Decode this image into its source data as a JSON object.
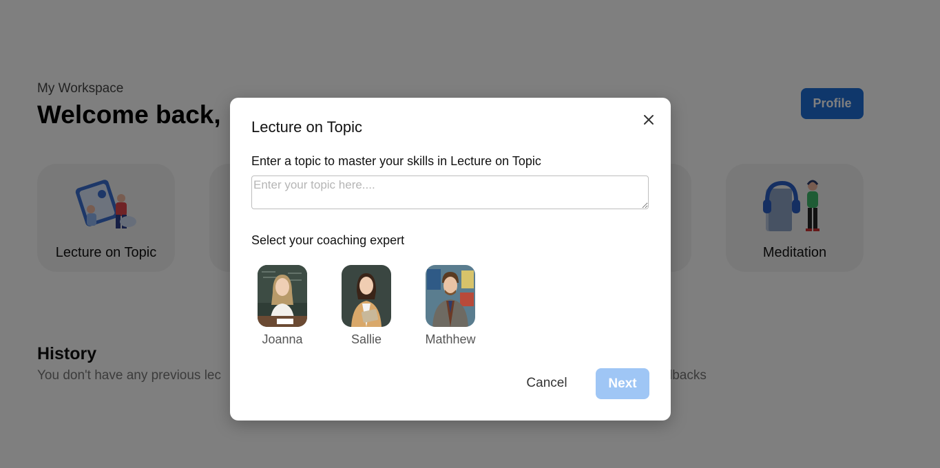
{
  "workspace": {
    "label": "My Workspace",
    "welcome": "Welcome back,",
    "profile_button": "Profile"
  },
  "cards": [
    {
      "label": "Lecture on Topic",
      "icon": "lecture-illustration-icon"
    },
    {
      "label": "",
      "icon": "hidden-card"
    },
    {
      "label": "",
      "icon": "hidden-card"
    },
    {
      "label": "",
      "icon": "hidden-card"
    },
    {
      "label": "Meditation",
      "icon": "meditation-illustration-icon"
    }
  ],
  "history": {
    "title": "History",
    "text_left": "You don't have any previous lec",
    "text_right": "lbacks"
  },
  "modal": {
    "title": "Lecture on Topic",
    "prompt": "Enter a topic to master your skills in Lecture on Topic",
    "topic_value": "",
    "topic_placeholder": "Enter your topic here....",
    "expert_prompt": "Select your coaching expert",
    "experts": [
      {
        "name": "Joanna"
      },
      {
        "name": "Sallie"
      },
      {
        "name": "Mathhew"
      }
    ],
    "cancel_label": "Cancel",
    "next_label": "Next"
  },
  "colors": {
    "accent": "#1f6fd6",
    "next_disabled": "#9fc6f5",
    "overlay": "rgba(0,0,0,0.5)"
  }
}
